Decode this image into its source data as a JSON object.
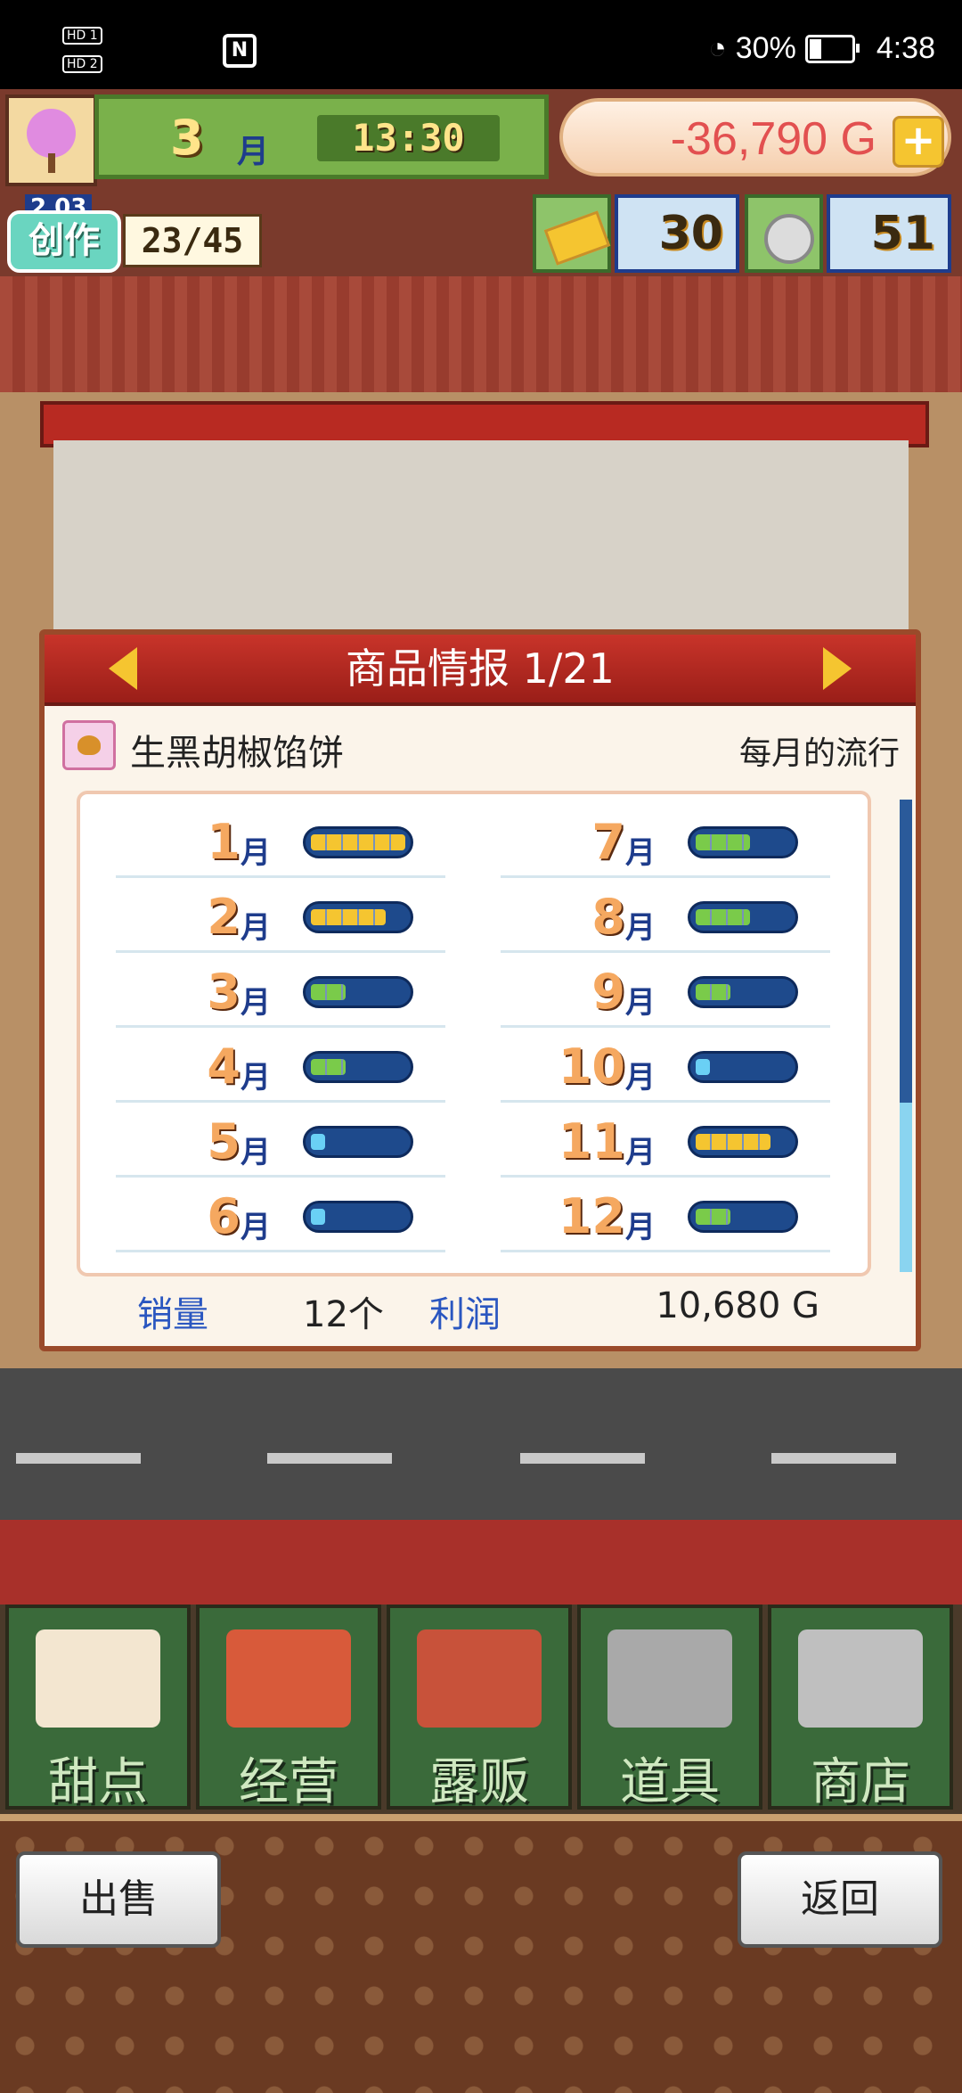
{
  "status_bar": {
    "hd1": "HD 1",
    "hd2": "HD 2",
    "nfc": "N",
    "battery_text": "30%",
    "battery_level": 0.3,
    "time": "4:38"
  },
  "hud": {
    "month": "3",
    "month_unit": "月",
    "clock": "13:30",
    "money": "-36,790 G",
    "plus": "+",
    "create_label": "创作",
    "create_level": "2 03",
    "create_count": "23/45",
    "gold": "30",
    "silver": "51"
  },
  "dialog": {
    "title": "商品情报 1/21",
    "item_name": "生黑胡椒馅饼",
    "trend_label": "每月的流行",
    "months_left": [
      {
        "num": "1",
        "unit": "月",
        "level": 5,
        "color": "#f5c530"
      },
      {
        "num": "2",
        "unit": "月",
        "level": 4,
        "color": "#f5c530"
      },
      {
        "num": "3",
        "unit": "月",
        "level": 2,
        "color": "#7acb4a"
      },
      {
        "num": "4",
        "unit": "月",
        "level": 2,
        "color": "#7acb4a"
      },
      {
        "num": "5",
        "unit": "月",
        "level": 1,
        "color": "#6ad0f5"
      },
      {
        "num": "6",
        "unit": "月",
        "level": 1,
        "color": "#6ad0f5"
      }
    ],
    "months_right": [
      {
        "num": "7",
        "unit": "月",
        "level": 3,
        "color": "#7acb4a"
      },
      {
        "num": "8",
        "unit": "月",
        "level": 3,
        "color": "#7acb4a"
      },
      {
        "num": "9",
        "unit": "月",
        "level": 2,
        "color": "#7acb4a"
      },
      {
        "num": "10",
        "unit": "月",
        "level": 1,
        "color": "#6ad0f5"
      },
      {
        "num": "11",
        "unit": "月",
        "level": 4,
        "color": "#f5c530"
      },
      {
        "num": "12",
        "unit": "月",
        "level": 2,
        "color": "#7acb4a"
      }
    ],
    "sales_label": "销量",
    "sales_value": "12个",
    "profit_label": "利润",
    "profit_value": "10,680 G"
  },
  "menu": [
    {
      "label": "甜点",
      "icon": "cake-icon",
      "color": "#f3e6d0"
    },
    {
      "label": "经营",
      "icon": "shop-icon",
      "color": "#d85a3a"
    },
    {
      "label": "露贩",
      "icon": "food-truck-icon",
      "color": "#c8523a"
    },
    {
      "label": "道具",
      "icon": "gear-bag-icon",
      "color": "#a9a9a9"
    },
    {
      "label": "商店",
      "icon": "cart-icon",
      "color": "#bfbfbf"
    }
  ],
  "buttons": {
    "sell": "出售",
    "back": "返回"
  }
}
